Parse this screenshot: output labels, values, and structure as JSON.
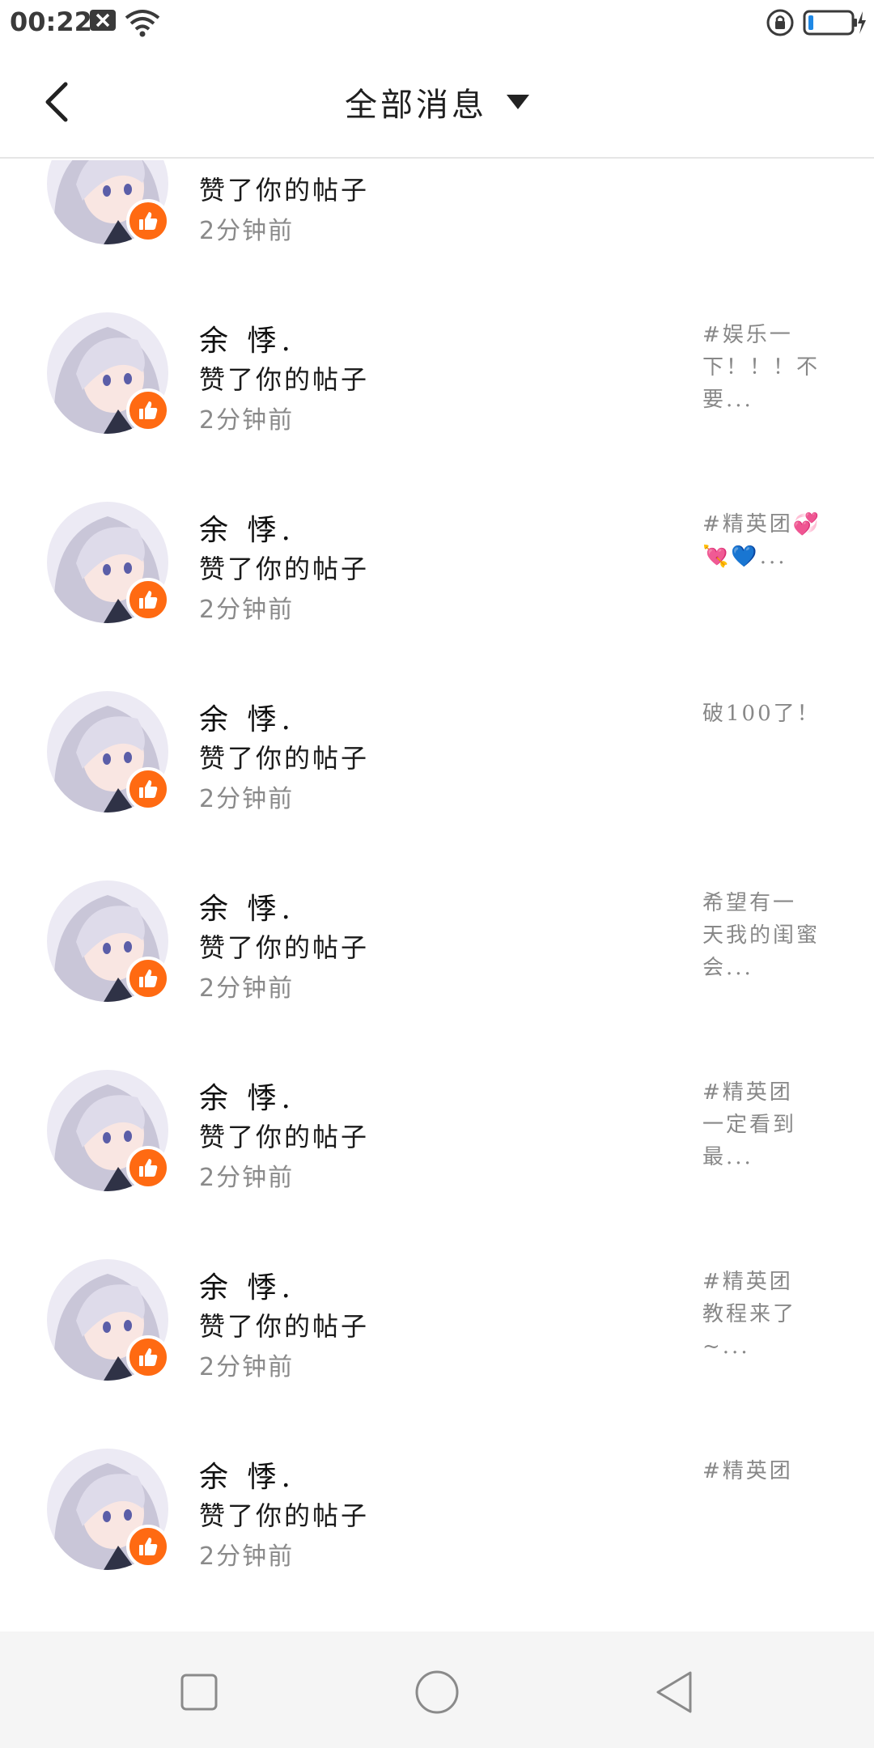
{
  "status_bar": {
    "time": "00:22",
    "icons": [
      "notification-x-icon",
      "wifi-icon",
      "rotation-lock-icon",
      "battery-charging-icon"
    ]
  },
  "header": {
    "title": "全部消息",
    "back_icon": "chevron-left-icon",
    "dropdown_icon": "caret-down-icon"
  },
  "notifications": [
    {
      "name": "",
      "action": "赞了你的帖子",
      "time": "2分钟前",
      "preview": ""
    },
    {
      "name": "余 悸.",
      "action": "赞了你的帖子",
      "time": "2分钟前",
      "preview": "#娱乐一\n下！！！不\n要..."
    },
    {
      "name": "余 悸.",
      "action": "赞了你的帖子",
      "time": "2分钟前",
      "preview": "#精英团💞\n💘💙..."
    },
    {
      "name": "余 悸.",
      "action": "赞了你的帖子",
      "time": "2分钟前",
      "preview": "破100了！"
    },
    {
      "name": "余 悸.",
      "action": "赞了你的帖子",
      "time": "2分钟前",
      "preview": "希望有一\n天我的闺蜜\n会..."
    },
    {
      "name": "余 悸.",
      "action": "赞了你的帖子",
      "time": "2分钟前",
      "preview": "#精英团\n一定看到\n最..."
    },
    {
      "name": "余 悸.",
      "action": "赞了你的帖子",
      "time": "2分钟前",
      "preview": "#精英团\n教程来了~..."
    },
    {
      "name": "余 悸.",
      "action": "赞了你的帖子",
      "time": "2分钟前",
      "preview": "#精英团"
    }
  ],
  "nav_bar": {
    "icons": [
      "recent-apps-square-icon",
      "home-circle-icon",
      "back-triangle-icon"
    ]
  },
  "colors": {
    "like_badge": "#ff6a12",
    "nav_background": "#f5f5f5",
    "divider": "#e6e6e6"
  }
}
